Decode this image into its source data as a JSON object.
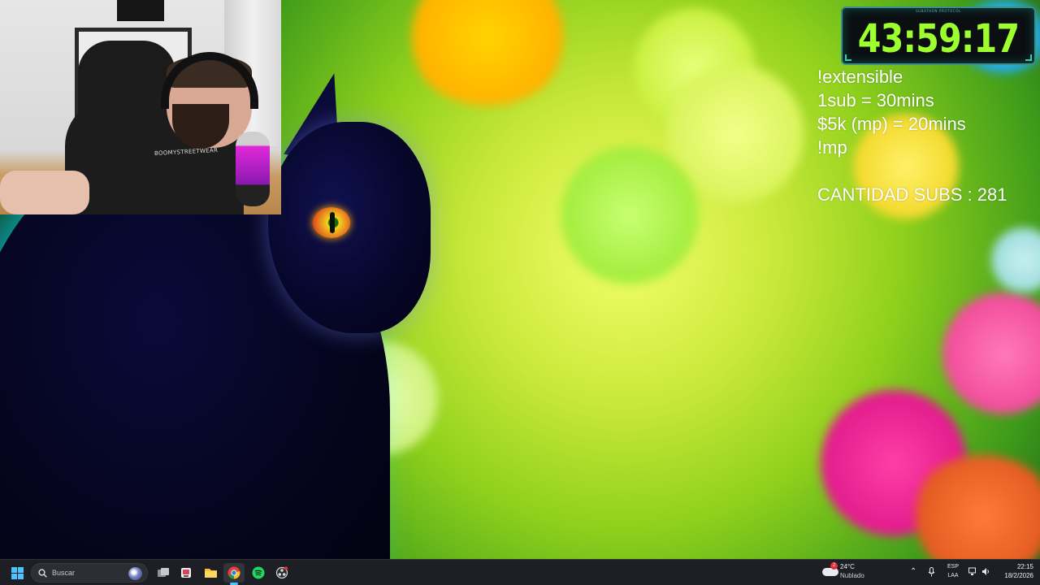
{
  "stream": {
    "timer": "43:59:17",
    "timer_caption": "SUBATHON PROTOCOL",
    "lines": [
      "!extensible",
      "1sub = 30mins",
      "$5k (mp) = 20mins",
      "!mp"
    ],
    "subs_label": "CANTIDAD SUBS :  281"
  },
  "webcam": {
    "shirt_text": "BOOMYSTREETWEAR"
  },
  "taskbar": {
    "search_label": "Buscar",
    "apps": [
      {
        "name": "task-view-icon"
      },
      {
        "name": "screenshot-tool-icon"
      },
      {
        "name": "file-explorer-icon"
      },
      {
        "name": "chrome-icon",
        "active": true
      },
      {
        "name": "spotify-icon"
      },
      {
        "name": "obs-icon"
      }
    ],
    "weather": {
      "temp": "24°C",
      "condition": "Nublado",
      "badge": "2"
    },
    "language": {
      "line1": "ESP",
      "line2": "LAA"
    },
    "clock": {
      "time": "22:15",
      "date": "18/2/2026"
    }
  },
  "colors": {
    "timer_text": "#9eff2e",
    "accent": "#4cc2ff",
    "taskbar_bg": "#1e1f24"
  }
}
